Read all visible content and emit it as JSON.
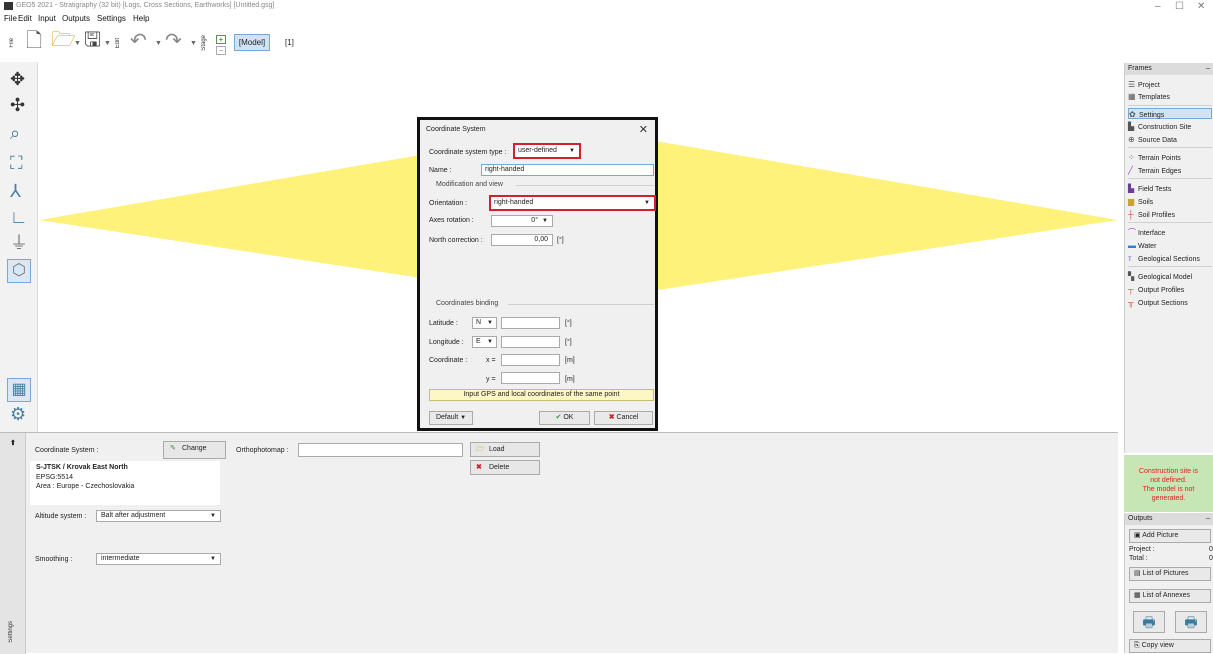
{
  "window": {
    "title": "GEO5 2021 - Stratigraphy (32 bit) [Logs, Cross Sections, Earthworks] [Untitled.gsg]",
    "minimize": "–",
    "maximize": "☐",
    "close": "✕"
  },
  "menu": [
    "File",
    "Edit",
    "Input",
    "Outputs",
    "Settings",
    "Help"
  ],
  "toolbar": {
    "file_label": "File",
    "edit_label": "Edit",
    "stage_label": "Stage",
    "model_button": "[Model]",
    "stage_number": "[1]",
    "stage_plus": "+",
    "stage_minus": "−"
  },
  "dialog": {
    "title": "Coordinate System",
    "close": "✕",
    "type_label": "Coordinate system type :",
    "type_value": "user-defined",
    "name_label": "Name :",
    "name_value": "right-handed",
    "section_modification": "Modification and view",
    "orientation_label": "Orientation :",
    "orientation_value": "right-handed",
    "axes_rotation_label": "Axes rotation :",
    "axes_rotation_value": "0°",
    "north_correction_label": "North correction :",
    "north_correction_value": "0,00",
    "deg_unit": "[°]",
    "section_binding": "Coordinates binding",
    "latitude_label": "Latitude :",
    "latitude_dir": "N",
    "longitude_label": "Longitude :",
    "longitude_dir": "E",
    "coordinate_label": "Coordinate :",
    "x_label": "x =",
    "y_label": "y =",
    "m_unit": "[m]",
    "hint": "Input GPS and local coordinates of the same point",
    "default_button": "Default",
    "ok_button": "OK",
    "cancel_button": "Cancel"
  },
  "bottom": {
    "side_tab": "Settings",
    "coord_system_label": "Coordinate System :",
    "change_button": "Change",
    "orthophotomap_label": "Orthophotomap :",
    "load_button": "Load",
    "delete_button": "Delete",
    "crs_name": "S-JTSK / Krovak East North",
    "crs_epsg": "EPSG:5514",
    "crs_area": "Area : Europe - Czechoslovakia",
    "altitude_label": "Altitude system :",
    "altitude_value": "Balt after adjustment",
    "smoothing_label": "Smoothing :",
    "smoothing_value": "intermediate"
  },
  "frames": {
    "header": "Frames",
    "items": [
      {
        "label": "Project",
        "icon": "☰"
      },
      {
        "label": "Templates",
        "icon": "▦"
      },
      {
        "label": "Settings",
        "icon": "✿"
      },
      {
        "label": "Construction Site",
        "icon": "▙"
      },
      {
        "label": "Source Data",
        "icon": "⊕"
      },
      {
        "label": "Terrain Points",
        "icon": "⁘"
      },
      {
        "label": "Terrain Edges",
        "icon": "╱"
      },
      {
        "label": "Field Tests",
        "icon": "▙"
      },
      {
        "label": "Soils",
        "icon": "▆"
      },
      {
        "label": "Soil Profiles",
        "icon": "┼"
      },
      {
        "label": "Interface",
        "icon": "⌒"
      },
      {
        "label": "Water",
        "icon": "▬"
      },
      {
        "label": "Geological Sections",
        "icon": "ᴛ"
      },
      {
        "label": "Geological Model",
        "icon": "▚"
      },
      {
        "label": "Output Profiles",
        "icon": "┬"
      },
      {
        "label": "Output Sections",
        "icon": "╥"
      }
    ]
  },
  "warning": {
    "line1": "Construction site is",
    "line2": "not defined.",
    "line3": "The model is not",
    "line4": "generated."
  },
  "outputs": {
    "header": "Outputs",
    "add_picture": "Add Picture",
    "project_label": "Project :",
    "project_count": "0",
    "total_label": "Total :",
    "total_count": "0",
    "list_pictures": "List of Pictures",
    "list_annexes": "List of Annexes",
    "copy_view": "Copy view"
  },
  "colors": {
    "terrain_fill": "#fff27a",
    "highlight": "#d3202a",
    "warning_bg": "#c7e6b6"
  }
}
